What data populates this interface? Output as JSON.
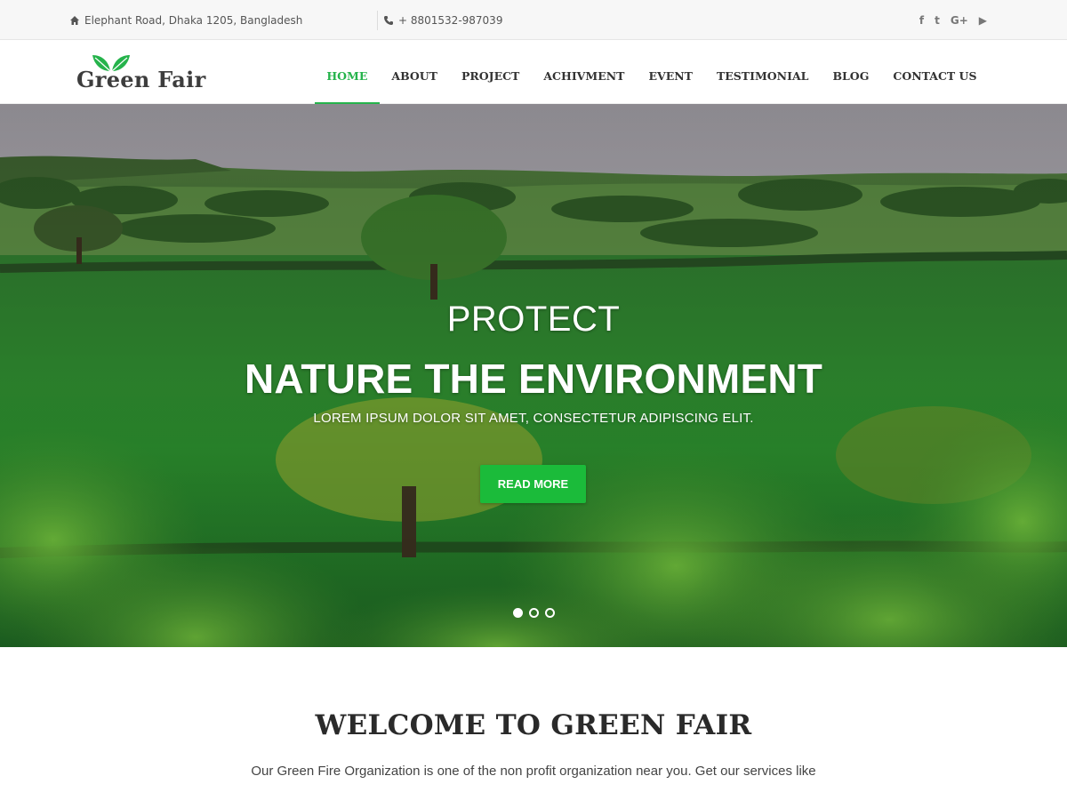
{
  "topbar": {
    "address": "Elephant Road, Dhaka 1205, Bangladesh",
    "phone": "+ 8801532-987039",
    "address_icon": "home-icon",
    "phone_icon": "phone-icon",
    "social": [
      {
        "icon": "facebook-icon",
        "glyph": "f"
      },
      {
        "icon": "twitter-icon",
        "glyph": "t"
      },
      {
        "icon": "google-plus-icon",
        "glyph": "G+"
      },
      {
        "icon": "youtube-icon",
        "glyph": "▶"
      }
    ]
  },
  "header": {
    "logo_text": "Green Fair",
    "nav": [
      {
        "label": "HOME",
        "active": true
      },
      {
        "label": "ABOUT",
        "active": false
      },
      {
        "label": "PROJECT",
        "active": false
      },
      {
        "label": "ACHIVMENT",
        "active": false
      },
      {
        "label": "EVENT",
        "active": false
      },
      {
        "label": "TESTIMONIAL",
        "active": false
      },
      {
        "label": "BLOG",
        "active": false
      },
      {
        "label": "CONTACT US",
        "active": false
      }
    ]
  },
  "hero": {
    "line1": "PROTECT",
    "line2": "NATURE THE ENVIRONMENT",
    "subtitle": "LOREM IPSUM DOLOR SIT AMET, CONSECTETUR ADIPISCING ELIT.",
    "button_label": "READ MORE",
    "slides_total": 3,
    "active_slide": 1
  },
  "welcome": {
    "title": "WELCOME TO GREEN FAIR",
    "text": "Our Green Fire Organization is one of the non profit organization near you. Get our services like"
  },
  "colors": {
    "accent": "#25b34b",
    "button": "#1bbb3a",
    "text_dark": "#2a2a2a"
  }
}
